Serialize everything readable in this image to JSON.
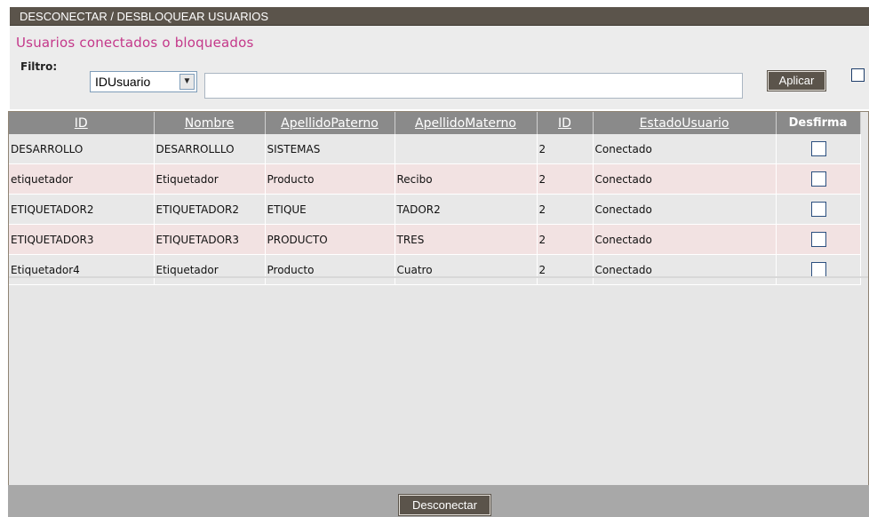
{
  "window": {
    "title": "DESCONECTAR / DESBLOQUEAR USUARIOS"
  },
  "header": {
    "subtitle": "Usuarios conectados o bloqueados"
  },
  "filter": {
    "label": "Filtro:",
    "selected_field": "IDUsuario",
    "search_value": "",
    "apply_label": "Aplicar"
  },
  "grid": {
    "columns": [
      "ID",
      "Nombre",
      "ApellidoPaterno",
      "ApellidoMaterno",
      "ID",
      "EstadoUsuario",
      "Desfirma"
    ],
    "rows": [
      {
        "id": "DESARROLLO",
        "nombre": "DESARROLLLO",
        "paterno": "SISTEMAS",
        "materno": "",
        "id2": "2",
        "estado": "Conectado"
      },
      {
        "id": "etiquetador",
        "nombre": "Etiquetador",
        "paterno": "Producto",
        "materno": "Recibo",
        "id2": "2",
        "estado": "Conectado"
      },
      {
        "id": "ETIQUETADOR2",
        "nombre": "ETIQUETADOR2",
        "paterno": "ETIQUE",
        "materno": "TADOR2",
        "id2": "2",
        "estado": "Conectado"
      },
      {
        "id": "ETIQUETADOR3",
        "nombre": "ETIQUETADOR3",
        "paterno": "PRODUCTO",
        "materno": "TRES",
        "id2": "2",
        "estado": "Conectado"
      },
      {
        "id": "Etiquetador4",
        "nombre": "Etiquetador",
        "paterno": "Producto",
        "materno": "Cuatro",
        "id2": "2",
        "estado": "Conectado"
      }
    ]
  },
  "footer": {
    "disconnect_label": "Desconectar"
  },
  "colors": {
    "accent": "#c4388a",
    "bar": "#5b544b",
    "header_row": "#8a8a8a"
  }
}
